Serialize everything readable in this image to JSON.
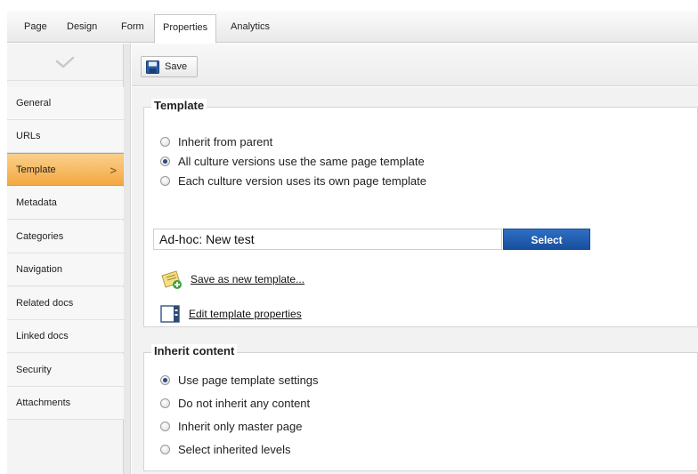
{
  "tabs": [
    {
      "label": "Page"
    },
    {
      "label": "Design"
    },
    {
      "label": "Form"
    },
    {
      "label": "Properties",
      "active": true
    },
    {
      "label": "Analytics"
    }
  ],
  "sidebar": {
    "items": [
      {
        "label": "General"
      },
      {
        "label": "URLs"
      },
      {
        "label": "Template",
        "active": true
      },
      {
        "label": "Metadata"
      },
      {
        "label": "Categories"
      },
      {
        "label": "Navigation"
      },
      {
        "label": "Related docs"
      },
      {
        "label": "Linked docs"
      },
      {
        "label": "Security"
      },
      {
        "label": "Attachments"
      }
    ],
    "active_chevron": ">"
  },
  "toolbar": {
    "save_label": "Save"
  },
  "template_section": {
    "legend": "Template",
    "options": [
      {
        "label": "Inherit from parent",
        "selected": false
      },
      {
        "label": "All culture versions use the same page template",
        "selected": true
      },
      {
        "label": "Each culture version uses its own page template",
        "selected": false
      }
    ],
    "template_value": "Ad-hoc: New test",
    "select_label": "Select",
    "save_as_new_label": "Save as new template...",
    "edit_properties_label": "Edit template properties"
  },
  "inherit_section": {
    "legend": "Inherit content",
    "options": [
      {
        "label": "Use page template settings",
        "selected": true
      },
      {
        "label": "Do not inherit any content",
        "selected": false
      },
      {
        "label": "Inherit only master page",
        "selected": false
      },
      {
        "label": "Select inherited levels",
        "selected": false
      }
    ]
  },
  "colors": {
    "accent": "#f2a840",
    "select_button": "#1f5fb3"
  }
}
